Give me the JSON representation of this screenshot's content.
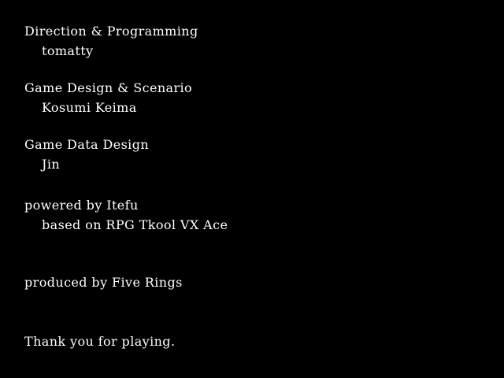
{
  "credits": {
    "direction_heading": "Direction & Programming",
    "direction_name": "tomatty",
    "design_heading": "Game Design & Scenario",
    "design_name": "Kosumi Keima",
    "data_heading": "Game Data Design",
    "data_name": "Jin",
    "engine_heading": "powered by Itefu",
    "engine_detail": "based on RPG Tkool VX Ace",
    "producer": "produced by Five Rings",
    "closing": "Thank you for playing."
  },
  "colors": {
    "background": "#000000",
    "text": "#ffffff"
  }
}
